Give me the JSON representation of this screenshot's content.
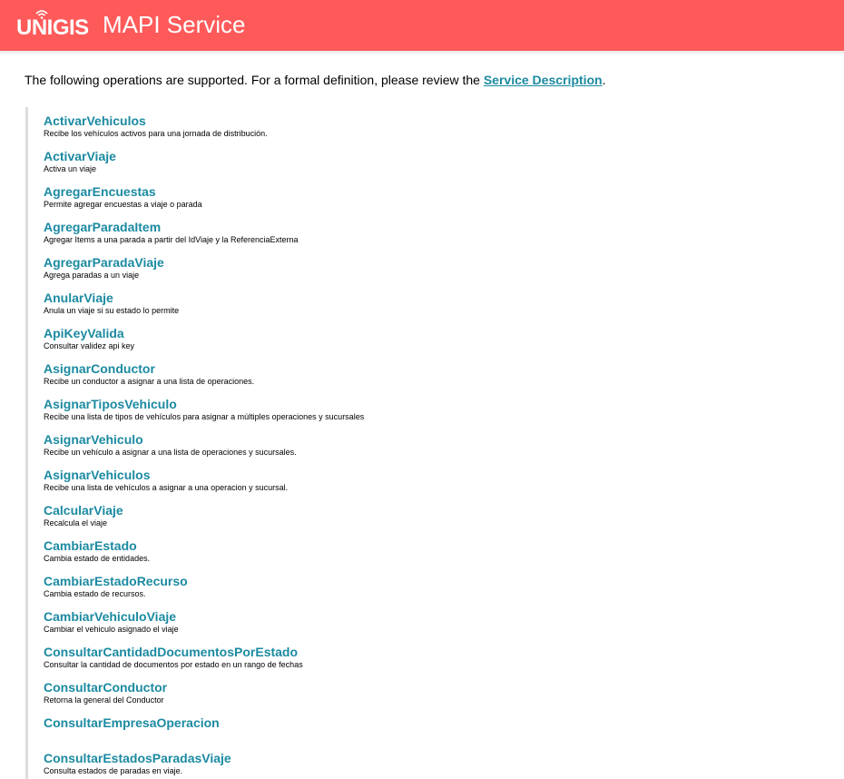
{
  "header": {
    "logo_text": "UNIGIS",
    "logo_icon": "wifi-icon",
    "title": "MAPI Service",
    "background_color": "#ff5a5a"
  },
  "intro": {
    "text": "The following operations are supported. For a formal definition, please review the ",
    "link_label": "Service Description",
    "trailing": ".",
    "link_color": "#1b8aa1"
  },
  "operations": [
    {
      "name": "ActivarVehiculos",
      "description": "Recibe los vehículos activos para una jornada de distribución."
    },
    {
      "name": "ActivarViaje",
      "description": "Activa un viaje"
    },
    {
      "name": "AgregarEncuestas",
      "description": "Permite agregar encuestas a viaje o parada"
    },
    {
      "name": "AgregarParadaItem",
      "description": "Agregar Items a una parada a partir del IdViaje y la ReferenciaExterna"
    },
    {
      "name": "AgregarParadaViaje",
      "description": "Agrega paradas a un viaje"
    },
    {
      "name": "AnularViaje",
      "description": "Anula un viaje si su estado lo permite"
    },
    {
      "name": "ApiKeyValida",
      "description": "Consultar validez api key"
    },
    {
      "name": "AsignarConductor",
      "description": "Recibe un conductor a asignar a una lista de operaciones."
    },
    {
      "name": "AsignarTiposVehiculo",
      "description": "Recibe una lista de tipos de vehículos para asignar a múltiples operaciones y sucursales"
    },
    {
      "name": "AsignarVehiculo",
      "description": "Recibe un vehículo a asignar a una lista de operaciones y sucursales."
    },
    {
      "name": "AsignarVehiculos",
      "description": "Recibe una lista de vehículos a asignar a una operacion y sucursal."
    },
    {
      "name": "CalcularViaje",
      "description": "Recalcula el viaje"
    },
    {
      "name": "CambiarEstado",
      "description": "Cambia estado de entidades."
    },
    {
      "name": "CambiarEstadoRecurso",
      "description": "Cambia estado de recursos."
    },
    {
      "name": "CambiarVehiculoViaje",
      "description": "Cambiar el vehiculo asignado el viaje"
    },
    {
      "name": "ConsultarCantidadDocumentosPorEstado",
      "description": "Consultar la cantidad de documentos por estado en un rango de fechas"
    },
    {
      "name": "ConsultarConductor",
      "description": "Retorna la general del Conductor"
    },
    {
      "name": "ConsultarEmpresaOperacion",
      "description": ""
    },
    {
      "name": "ConsultarEstadosParadasViaje",
      "description": "Consulta estados de paradas en viaje."
    }
  ]
}
